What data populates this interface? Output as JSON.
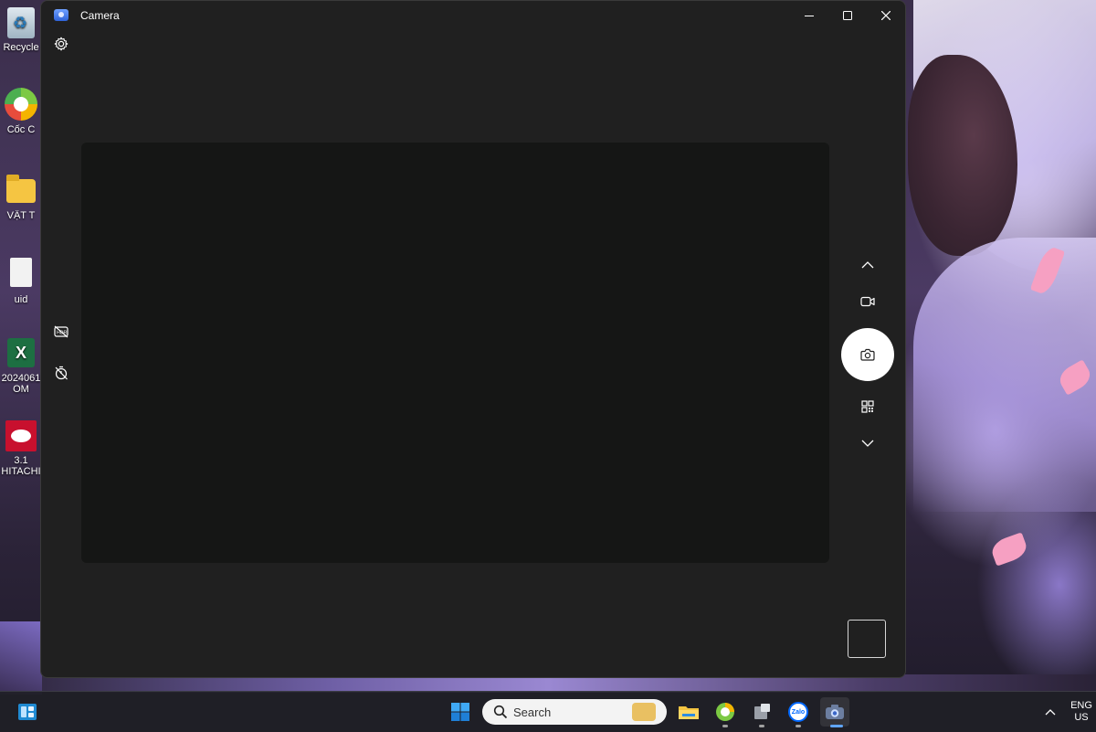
{
  "desktop": {
    "icons": [
      {
        "label": "Recycle",
        "icon": "recycle-bin-icon"
      },
      {
        "label": "Cốc C",
        "icon": "coccoc-icon"
      },
      {
        "label": "VẬT T",
        "icon": "folder-icon"
      },
      {
        "label": "uid",
        "icon": "file-icon"
      },
      {
        "label": "2024061",
        "label2": "OM",
        "icon": "excel-icon"
      },
      {
        "label": "3.1",
        "label2": "HITACHI",
        "icon": "hitachi-icon"
      }
    ]
  },
  "window": {
    "title": "Camera",
    "app_icon": "camera-app-icon",
    "controls": {
      "minimize": "—",
      "maximize": "▢",
      "close": "✕"
    }
  },
  "camera": {
    "left_controls": [
      "settings-icon",
      "hdr-off-icon",
      "timer-off-icon"
    ],
    "right_controls": [
      "chevron-up-icon",
      "video-mode-icon",
      "photo-shutter-icon",
      "qr-scan-icon",
      "chevron-down-icon"
    ],
    "preview_color": "#151615"
  },
  "taskbar": {
    "search_placeholder": "Search",
    "apps": [
      "widgets-icon",
      "start-icon",
      "file-explorer-icon",
      "coccoc-browser-icon",
      "app-icon",
      "zalo-icon",
      "camera-icon"
    ],
    "zalo_label": "Zalo",
    "language": {
      "line1": "ENG",
      "line2": "US"
    },
    "accent": "#60a5ff"
  }
}
